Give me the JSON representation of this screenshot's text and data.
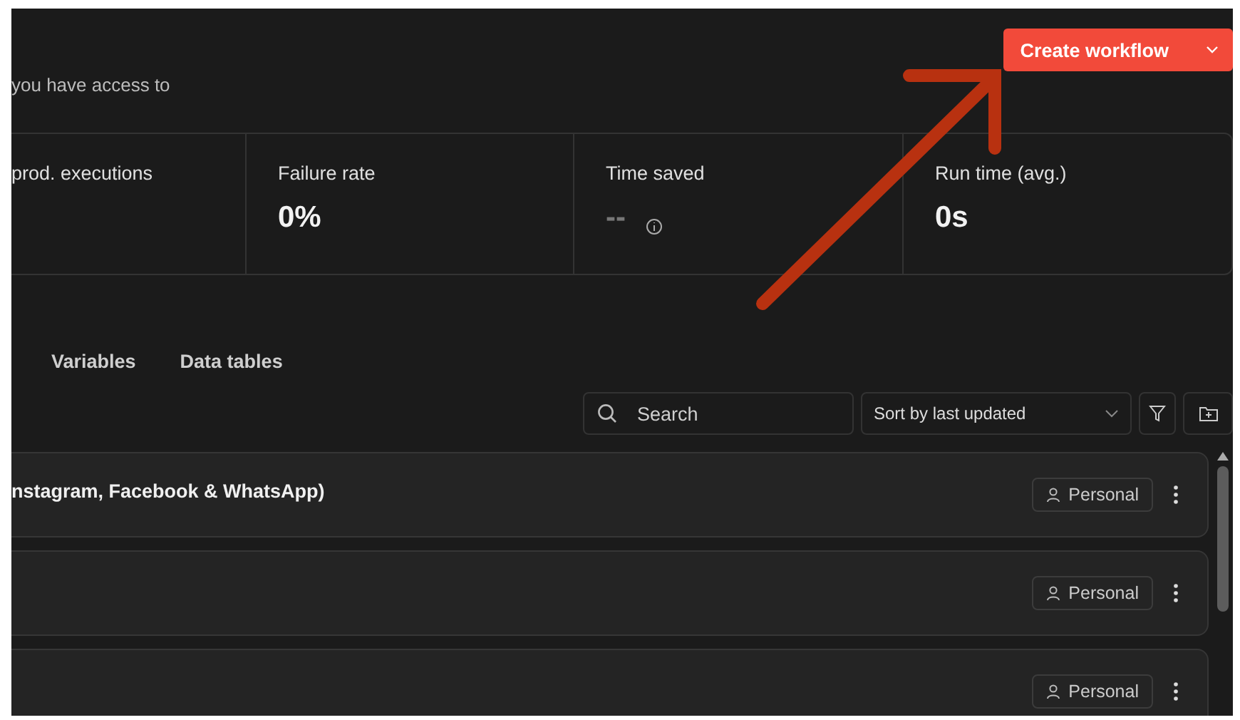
{
  "header": {
    "subtitle": "you have access to",
    "create_button": {
      "label": "Create workflow"
    }
  },
  "stats": [
    {
      "label": "prod. executions"
    },
    {
      "label": "Failure rate",
      "value": "0%"
    },
    {
      "label": "Time saved",
      "value": "--",
      "info": true
    },
    {
      "label": "Run time (avg.)",
      "value": "0s"
    }
  ],
  "tabs": [
    {
      "label": "Variables"
    },
    {
      "label": "Data tables"
    }
  ],
  "toolbar": {
    "search": {
      "placeholder": "Search"
    },
    "sort": {
      "value": "Sort by last updated"
    }
  },
  "workflows": [
    {
      "name": "nstagram, Facebook & WhatsApp)",
      "owner": "Personal"
    },
    {
      "owner": "Personal"
    },
    {
      "owner": "Personal"
    }
  ]
}
